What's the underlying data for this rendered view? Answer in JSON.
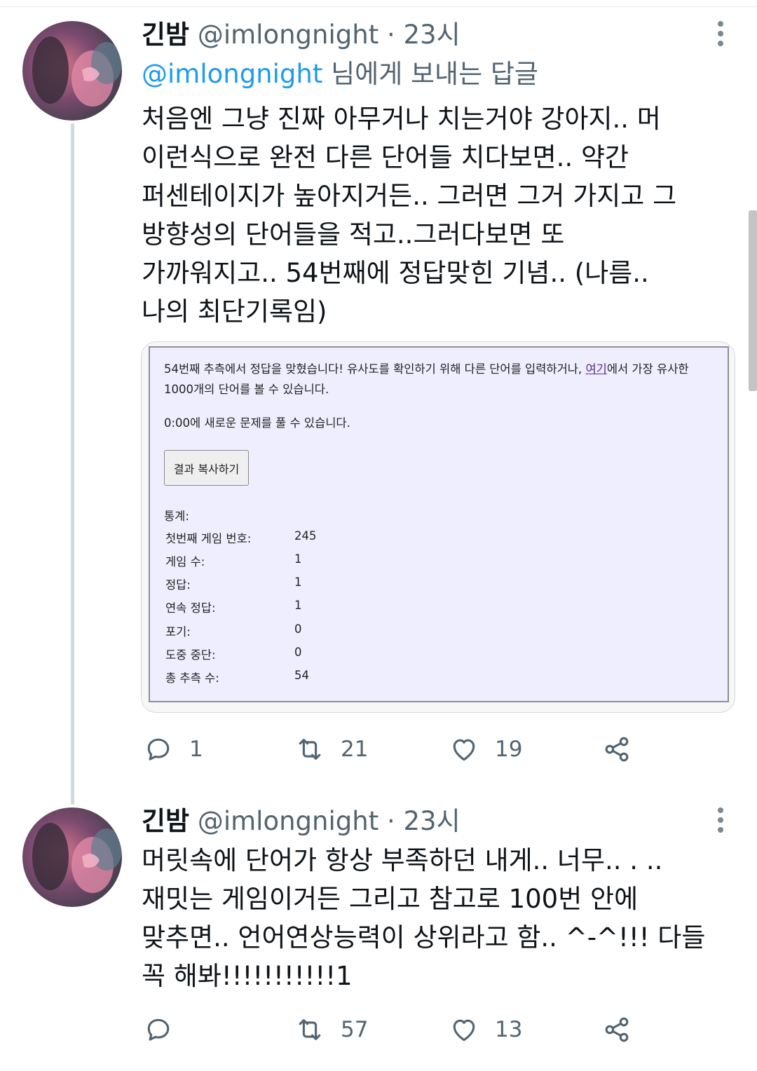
{
  "tweets": [
    {
      "name": "긴밤",
      "handle": "@imlongnight · 23시",
      "reply_prefix": "@imlongnight",
      "reply_suffix": " 님에게 보내는 답글",
      "text": "처음엔 그냥 진짜 아무거나 치는거야 강아지.. 머\n이런식으로 완전 다른 단어들 치다보면.. 약간\n퍼센테이지가 높아지거든.. 그러면 그거 가지고 그\n방향성의 단어들을 적고..그러다보면 또\n가까워지고.. 54번째에 정답맞힌 기념.. (나름..\n나의 최단기록임)",
      "replies": "1",
      "retweets": "21",
      "likes": "19"
    },
    {
      "name": "긴밤",
      "handle": "@imlongnight · 23시",
      "text": "머릿속에 단어가 항상 부족하던 내게.. 너무.. . ..\n재밋는 게임이거든 그리고 참고로 100번 안에\n맞추면.. 언어연상능력이 상위라고 함.. ^-^!!! 다들\n꼭 해봐!!!!!!!!!!!1",
      "replies": "",
      "retweets": "57",
      "likes": "13"
    }
  ],
  "screenshot": {
    "line1_pre": "54번째 추측에서 정답을 맞혔습니다! 유사도를 확인하기 위해 다른 단어를 입력하거나, ",
    "line1_link": "여기",
    "line1_post": "에서 가장 유사한",
    "line2": "1000개의 단어를 볼 수 있습니다.",
    "line3": "0:00에 새로운 문제를 풀 수 있습니다.",
    "copy_button": "결과 복사하기",
    "stats_title": "통계:",
    "stats": [
      {
        "label": "첫번째 게임 번호:",
        "value": "245"
      },
      {
        "label": "게임 수:",
        "value": "1"
      },
      {
        "label": "정답:",
        "value": "1"
      },
      {
        "label": "연속 정답:",
        "value": "1"
      },
      {
        "label": "포기:",
        "value": "0"
      },
      {
        "label": "도중 중단:",
        "value": "0"
      },
      {
        "label": "총 추측 수:",
        "value": "54"
      }
    ]
  },
  "icons": {
    "reply": "speech-bubble-icon",
    "retweet": "retweet-arrows-icon",
    "like": "heart-icon",
    "share": "share-nodes-icon",
    "more": "vertical-dots-icon"
  },
  "colors": {
    "link_blue": "#1d9bf0",
    "secondary_gray": "#536471",
    "screenshot_bg": "#eeeeff"
  }
}
